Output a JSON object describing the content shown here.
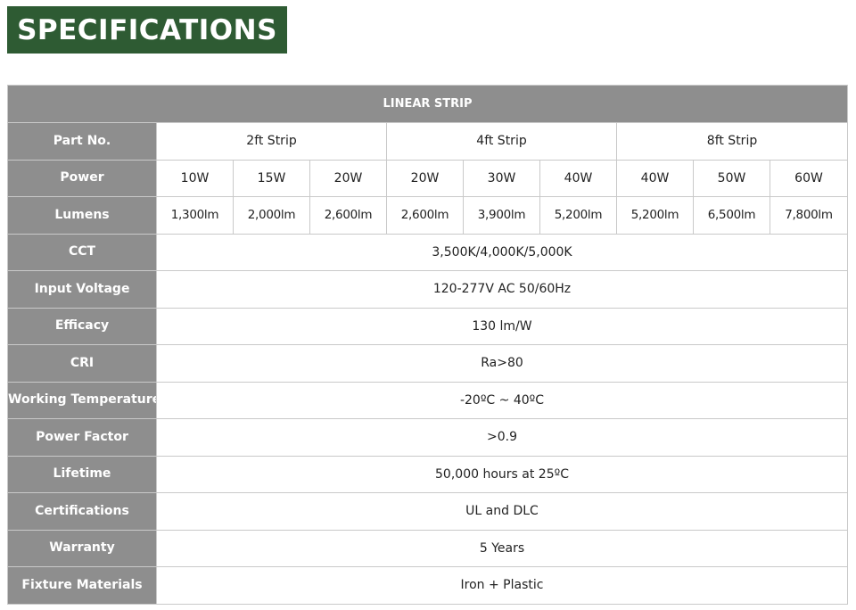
{
  "banner": {
    "title": "SPECIFICATIONS"
  },
  "table": {
    "title": "LINEAR STRIP",
    "part_no": {
      "label": "Part No.",
      "groups": [
        "2ft Strip",
        "4ft Strip",
        "8ft Strip"
      ]
    },
    "power": {
      "label": "Power",
      "values": [
        "10W",
        "15W",
        "20W",
        "20W",
        "30W",
        "40W",
        "40W",
        "50W",
        "60W"
      ]
    },
    "lumens": {
      "label": "Lumens",
      "values": [
        "1,300lm",
        "2,000lm",
        "2,600lm",
        "2,600lm",
        "3,900lm",
        "5,200lm",
        "5,200lm",
        "6,500lm",
        "7,800lm"
      ]
    },
    "rows": [
      {
        "label": "CCT",
        "value": "3,500K/4,000K/5,000K"
      },
      {
        "label": "Input Voltage",
        "value": "120-277V AC 50/60Hz"
      },
      {
        "label": "Efficacy",
        "value": "130 lm/W"
      },
      {
        "label": "CRI",
        "value": "Ra>80"
      },
      {
        "label": "Working Temperature",
        "value": "-20ºC ~ 40ºC"
      },
      {
        "label": "Power Factor",
        "value": ">0.9"
      },
      {
        "label": "Lifetime",
        "value": "50,000 hours at 25ºC"
      },
      {
        "label": "Certifications",
        "value": "UL and DLC"
      },
      {
        "label": "Warranty",
        "value": "5 Years"
      },
      {
        "label": "Fixture Materials",
        "value": "Iron + Plastic"
      }
    ]
  },
  "colors": {
    "banner_bg": "#2e5b33",
    "header_bg": "#8e8e8e",
    "border": "#c9c9c9"
  }
}
